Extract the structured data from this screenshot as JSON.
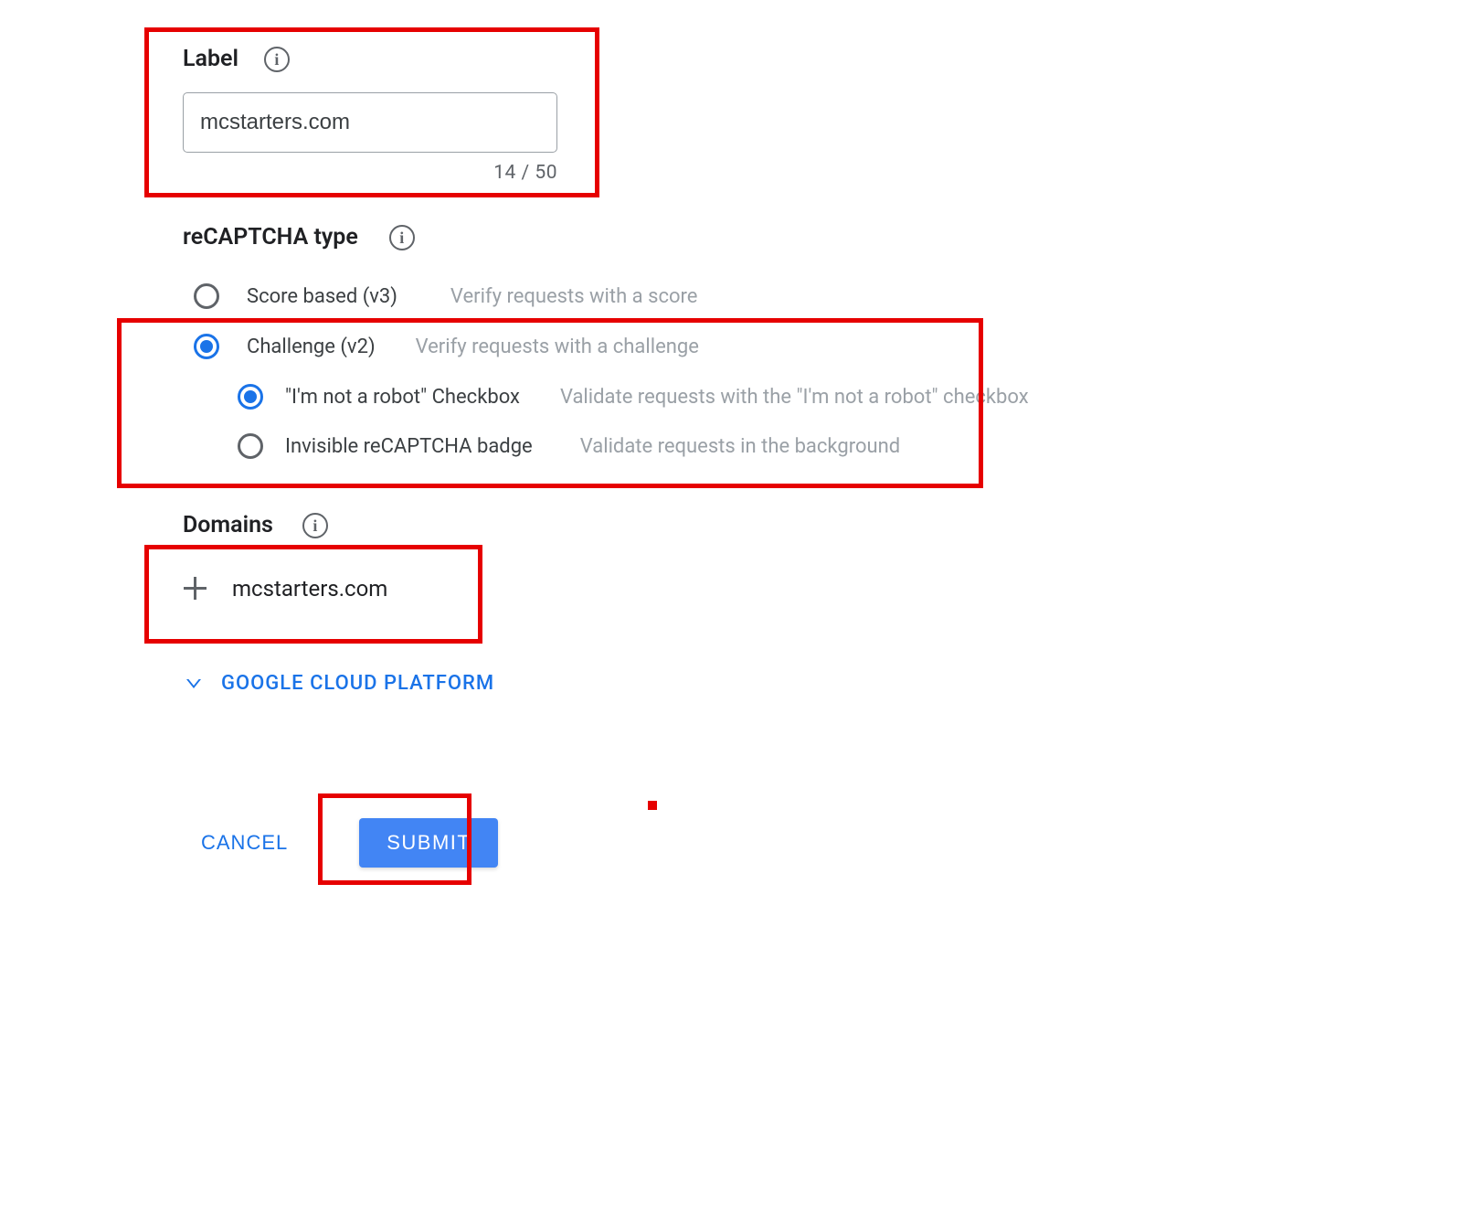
{
  "label": {
    "heading": "Label",
    "value": "mcstarters.com",
    "counter": "14 / 50"
  },
  "type": {
    "heading": "reCAPTCHA type",
    "options": [
      {
        "label": "Score based (v3)",
        "desc": "Verify requests with a score",
        "selected": false
      },
      {
        "label": "Challenge (v2)",
        "desc": "Verify requests with a challenge",
        "selected": true
      }
    ],
    "sub_options": [
      {
        "label": "\"I'm not a robot\" Checkbox",
        "desc": "Validate requests with the \"I'm not a robot\" checkbox",
        "selected": true
      },
      {
        "label": "Invisible reCAPTCHA badge",
        "desc": "Validate requests in the background",
        "selected": false
      }
    ]
  },
  "domains": {
    "heading": "Domains",
    "item": "mcstarters.com"
  },
  "gcp": {
    "label": "GOOGLE CLOUD PLATFORM"
  },
  "actions": {
    "cancel": "CANCEL",
    "submit": "SUBMIT"
  }
}
